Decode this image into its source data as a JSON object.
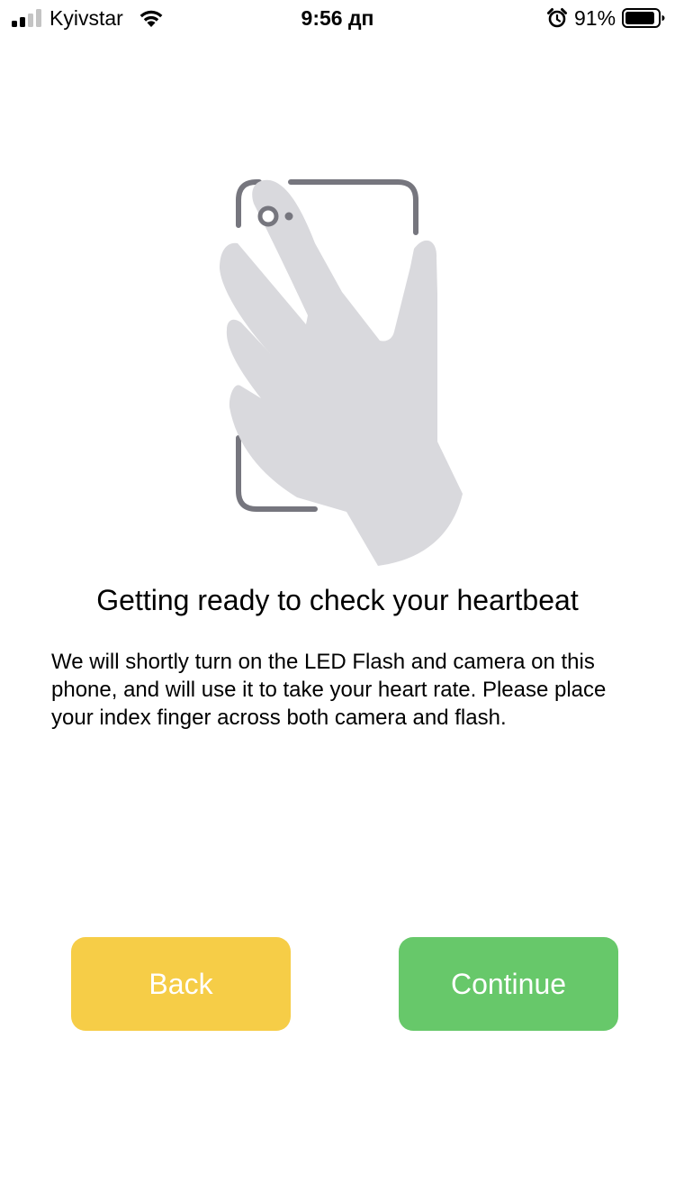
{
  "status_bar": {
    "carrier": "Kyivstar",
    "time": "9:56 дп",
    "battery_percent": "91%",
    "battery_level": 0.91,
    "signal_bars_active": 2,
    "signal_bars_total": 4,
    "icons": [
      "cellular-signal-icon",
      "wifi-icon",
      "alarm-icon",
      "battery-icon"
    ]
  },
  "illustration": {
    "icon": "hand-on-phone-camera-icon",
    "hand_color": "#d9d9dd",
    "phone_outline_color": "#76767e"
  },
  "main": {
    "title": "Getting ready to check your heartbeat",
    "description": "We will shortly turn on the LED Flash and camera on this phone, and will use it to take your heart rate. Please place your index finger across both camera and flash."
  },
  "buttons": {
    "back_label": "Back",
    "back_color": "#f6cd47",
    "continue_label": "Continue",
    "continue_color": "#67c86a"
  }
}
